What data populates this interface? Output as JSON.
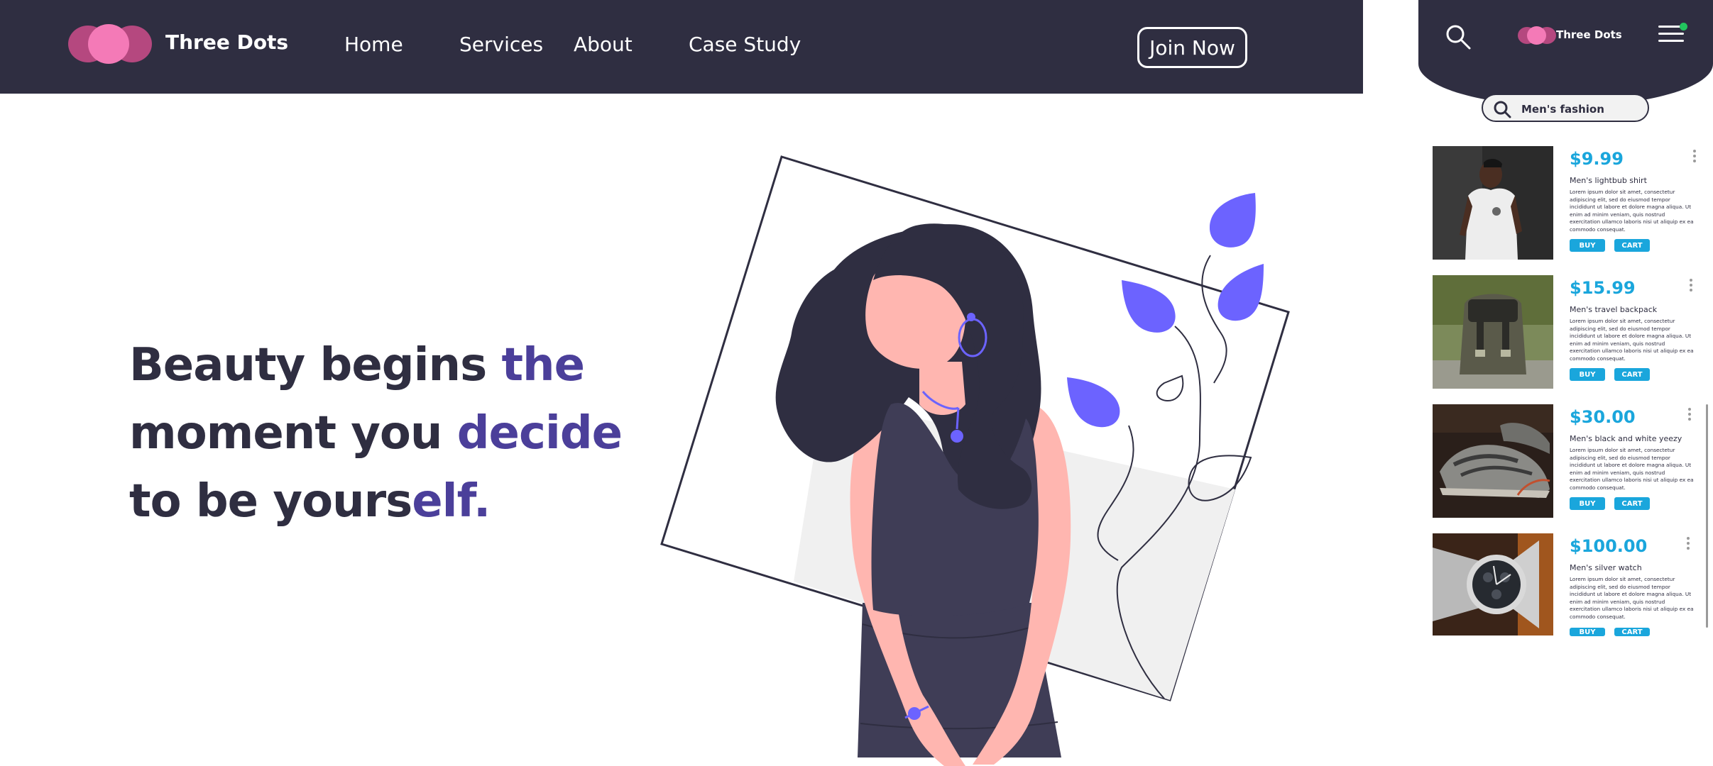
{
  "header": {
    "brand": "Three Dots",
    "nav": [
      "Home",
      "Services",
      "About",
      "Case Study"
    ],
    "join_label": "Join Now"
  },
  "hero": {
    "line1_a": "Beauty begins ",
    "line1_b": "the",
    "line2_a": "moment you ",
    "line2_b": "decide",
    "line3_a": "to be yours",
    "line3_b": "elf."
  },
  "mobile": {
    "brand": "Three Dots",
    "search_value": "Men's fashion",
    "buy_label": "BUY",
    "cart_label": "CART",
    "products": [
      {
        "price": "$9.99",
        "name": "Men's lightbub shirt",
        "desc": "Lorem ipsum dolor sit amet, consectetur adipiscing elit, sed do eiusmod tempor incididunt ut labore et dolore magna aliqua. Ut enim ad minim veniam, quis nostrud exercitation ullamco laboris nisi ut aliquip ex ea commodo consequat."
      },
      {
        "price": "$15.99",
        "name": "Men's travel backpack",
        "desc": "Lorem ipsum dolor sit amet, consectetur adipiscing elit, sed do eiusmod tempor incididunt ut labore et dolore magna aliqua. Ut enim ad minim veniam, quis nostrud exercitation ullamco laboris nisi ut aliquip ex ea commodo consequat."
      },
      {
        "price": "$30.00",
        "name": "Men's black and white yeezy",
        "desc": "Lorem ipsum dolor sit amet, consectetur adipiscing elit, sed do eiusmod tempor incididunt ut labore et dolore magna aliqua. Ut enim ad minim veniam, quis nostrud exercitation ullamco laboris nisi ut aliquip ex ea commodo consequat."
      },
      {
        "price": "$100.00",
        "name": "Men's silver watch",
        "desc": "Lorem ipsum dolor sit amet, consectetur adipiscing elit, sed do eiusmod tempor incididunt ut labore et dolore magna aliqua. Ut enim ad minim veniam, quis nostrud exercitation ullamco laboris nisi ut aliquip ex ea commodo consequat."
      }
    ]
  },
  "colors": {
    "header_bg": "#2f2e41",
    "logo_pink": "#f47ab7",
    "logo_magenta": "#b5487f",
    "accent_purple": "#4b3f9a",
    "leaf_purple": "#6c63ff",
    "price_blue": "#1aa6dc",
    "skin": "#ffb6b0"
  }
}
